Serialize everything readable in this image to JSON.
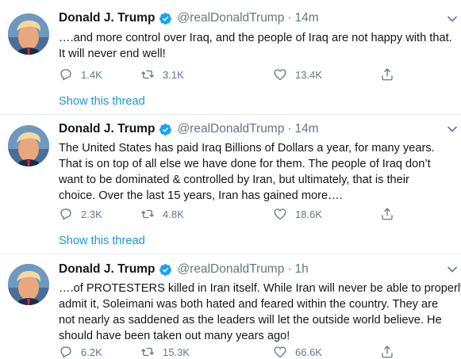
{
  "tweets": [
    {
      "name": "Donald J. Trump",
      "handle": "@realDonaldTrump",
      "separator": "·",
      "time": "14m",
      "lines": [
        "….and more control over Iraq, and the people of Iraq are not happy with that.",
        "It will never end well!"
      ],
      "replies": "1.4K",
      "retweets": "3.1K",
      "likes": "13.4K",
      "thread_link": "Show this thread"
    },
    {
      "name": "Donald J. Trump",
      "handle": "@realDonaldTrump",
      "separator": "·",
      "time": "14m",
      "lines": [
        "The United States has paid Iraq Billions of Dollars a year, for many years.",
        "That is on top of all else we have done for them. The people of Iraq don’t",
        "want to be dominated & controlled by Iran, but ultimately, that is their",
        "choice. Over the last 15 years, Iran has gained more…."
      ],
      "replies": "2.3K",
      "retweets": "4.8K",
      "likes": "18.6K",
      "thread_link": "Show this thread"
    },
    {
      "name": "Donald J. Trump",
      "handle": "@realDonaldTrump",
      "separator": "·",
      "time": "1h",
      "lines": [
        "….of PROTESTERS killed in Iran itself. While Iran will never be able to properly",
        "admit it, Soleimani was both hated and feared within the country. They are",
        "not nearly as saddened as the leaders will let the outside world believe. He",
        "should have been taken out many years ago!"
      ],
      "replies": "6.2K",
      "retweets": "15.3K",
      "likes": "66.6K"
    }
  ],
  "colors": {
    "accent": "#1b95e0",
    "verified": "#1da1f2",
    "muted": "#657786",
    "divider": "#e6ecf0"
  },
  "icons": [
    "avatar",
    "verified-badge-icon",
    "chevron-down-icon",
    "reply-icon",
    "retweet-icon",
    "like-icon",
    "share-icon"
  ]
}
